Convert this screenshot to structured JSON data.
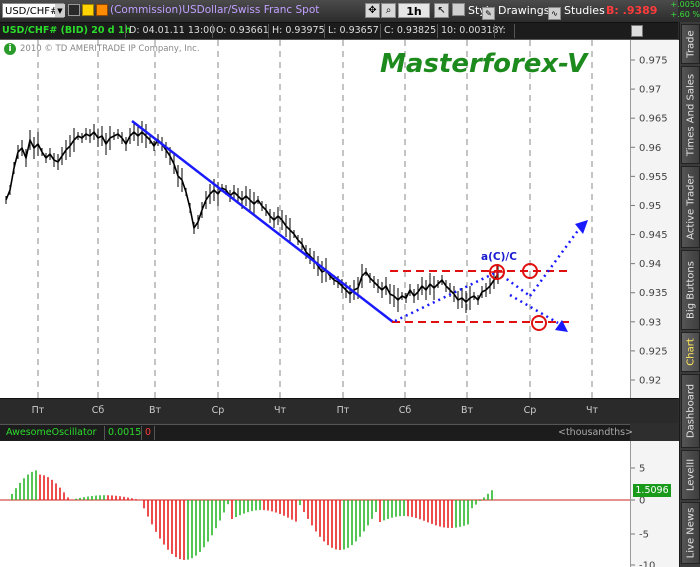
{
  "toolbar": {
    "symbol": "USD/CHF#",
    "description": "(Commission)USDollar/Swiss Franc Spot",
    "timeframe": "1h",
    "style_label": "Style",
    "drawings_label": "Drawings",
    "studies_label": "Studies",
    "bid_prefix": "B:",
    "bid_value": ".9389",
    "change_top": "+.0050",
    "change_bottom": "+.60 %"
  },
  "infobar": {
    "symbol_period": "USD/CHF# (BID) 20 d 1h",
    "date": "D: 04.01.11 13:00",
    "open": "O: 0.93661",
    "high": "H: 0.93975",
    "low": "L: 0.93657",
    "close": "C: 0.93825",
    "range": "10: 0.00318",
    "y": "Y:"
  },
  "chart": {
    "watermark": "Masterforex-V",
    "copyright": "2010 © TD AMERITRADE IP Company, Inc.",
    "annotation": "a(C)/C",
    "y_ticks": [
      "0.975",
      "0.97",
      "0.965",
      "0.96",
      "0.955",
      "0.95",
      "0.945",
      "0.94",
      "0.935",
      "0.93",
      "0.925",
      "0.92"
    ],
    "x_ticks": [
      "Пт",
      "Сб",
      "Вт",
      "Ср",
      "Чт",
      "Пт",
      "Сб",
      "Вт",
      "Ср",
      "Чт"
    ]
  },
  "oscillator": {
    "name": "AwesomeOscillator",
    "value": "0.0015",
    "flag": "0",
    "units": "<thousandths>",
    "last_value": "1.5096",
    "y_ticks": [
      "5",
      "0",
      "-5",
      "-10"
    ]
  },
  "side_tabs": [
    "Trade",
    "Times And Sales",
    "Active Trader",
    "Big Buttons",
    "Chart",
    "Dashboard",
    "LevelII",
    "Live News"
  ],
  "colors": {
    "trendline": "#1a1aff",
    "level": "#e01010",
    "watermark": "#1c8a1c",
    "osc_up": "#2ab82a",
    "osc_down": "#e82020",
    "bid": "#ff3b3b",
    "green_text": "#2bdc2b"
  },
  "icons": [
    "symbol-dropdown-icon",
    "link-icon",
    "favorite-icon",
    "settings-icon",
    "crosshair-icon",
    "zoom-icon",
    "pan-icon",
    "cursor-icon",
    "style-icon",
    "drawings-icon",
    "studies-icon",
    "info-icon"
  ]
}
